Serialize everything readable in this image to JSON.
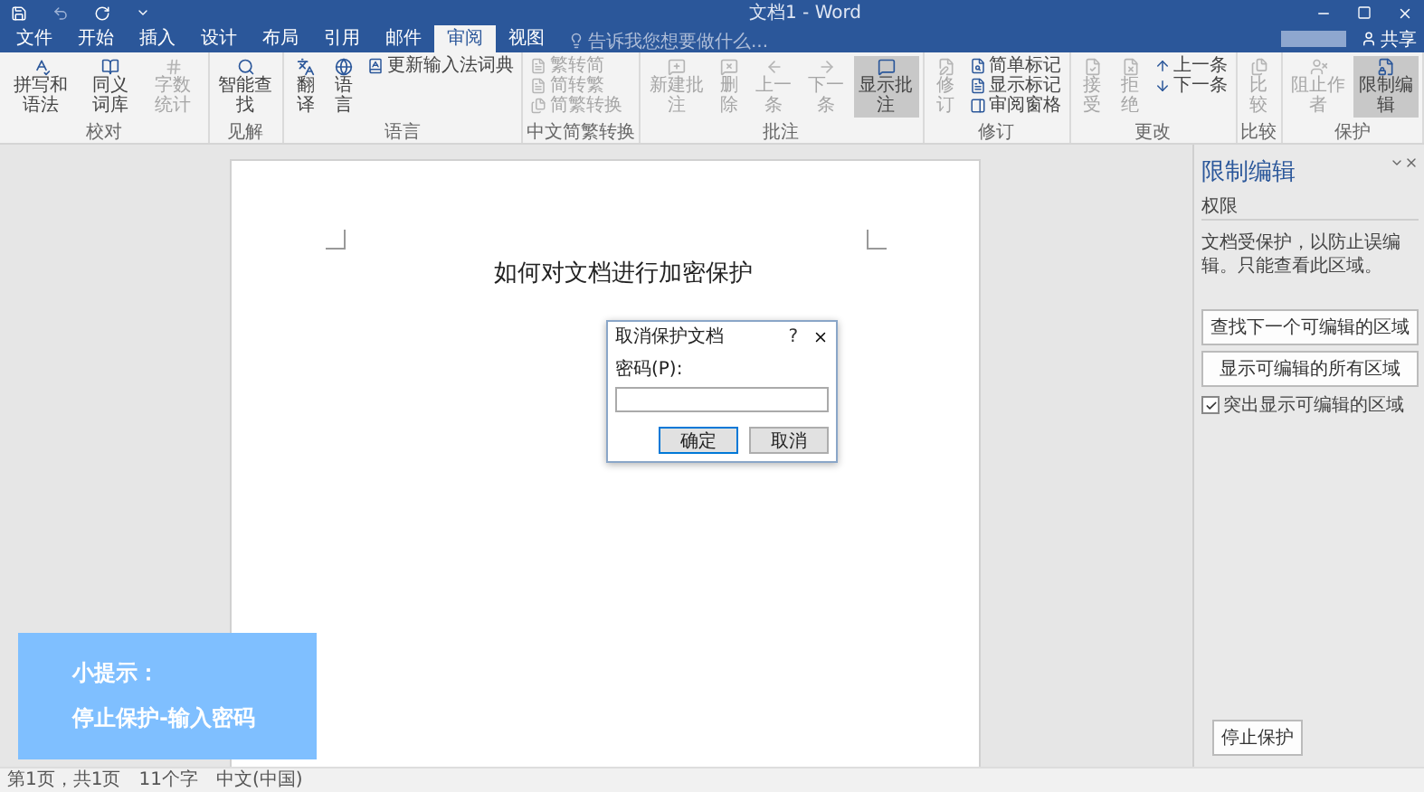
{
  "window": {
    "title": "文档1 - Word",
    "share": "共享"
  },
  "tabs": [
    {
      "label": "文件",
      "selected": false
    },
    {
      "label": "开始",
      "selected": false
    },
    {
      "label": "插入",
      "selected": false
    },
    {
      "label": "设计",
      "selected": false
    },
    {
      "label": "布局",
      "selected": false
    },
    {
      "label": "引用",
      "selected": false
    },
    {
      "label": "邮件",
      "selected": false
    },
    {
      "label": "审阅",
      "selected": true
    },
    {
      "label": "视图",
      "selected": false
    }
  ],
  "search": {
    "placeholder": "告诉我您想要做什么..."
  },
  "ribbon": {
    "groups": [
      {
        "label": "校对",
        "items": [
          {
            "label": "拼写和语法",
            "kind": "large",
            "selected": false,
            "disabled": false
          },
          {
            "label": "同义词库",
            "kind": "large",
            "selected": false,
            "disabled": false
          },
          {
            "label": "字数统计",
            "kind": "large",
            "selected": false,
            "disabled": true
          }
        ]
      },
      {
        "label": "见解",
        "items": [
          {
            "label": "智能查找",
            "kind": "large",
            "selected": false,
            "disabled": false
          }
        ]
      },
      {
        "label": "语言",
        "items": [
          {
            "label": "翻译",
            "kind": "large",
            "selected": false,
            "disabled": false
          },
          {
            "label": "语言",
            "kind": "large",
            "selected": false,
            "disabled": false
          },
          {
            "label": "更新输入法词典",
            "kind": "small",
            "selected": false,
            "disabled": false
          }
        ]
      },
      {
        "label": "中文简繁转换",
        "items": [
          {
            "label": "繁转简",
            "kind": "small",
            "selected": false,
            "disabled": true
          },
          {
            "label": "简转繁",
            "kind": "small",
            "selected": false,
            "disabled": true
          },
          {
            "label": "简繁转换",
            "kind": "small",
            "selected": false,
            "disabled": true
          }
        ]
      },
      {
        "label": "批注",
        "items": [
          {
            "label": "新建批注",
            "kind": "large",
            "selected": false,
            "disabled": true
          },
          {
            "label": "删除",
            "kind": "large",
            "selected": false,
            "disabled": true
          },
          {
            "label": "上一条",
            "kind": "large",
            "selected": false,
            "disabled": true
          },
          {
            "label": "下一条",
            "kind": "large",
            "selected": false,
            "disabled": true
          },
          {
            "label": "显示批注",
            "kind": "large",
            "selected": true,
            "disabled": false
          }
        ]
      },
      {
        "label": "修订",
        "items": [
          {
            "label": "修订",
            "kind": "large",
            "selected": false,
            "disabled": true
          },
          {
            "label": "简单标记",
            "kind": "small",
            "selected": false,
            "disabled": false
          },
          {
            "label": "显示标记",
            "kind": "small",
            "selected": false,
            "disabled": false
          },
          {
            "label": "审阅窗格",
            "kind": "small",
            "selected": false,
            "disabled": false
          }
        ]
      },
      {
        "label": "更改",
        "items": [
          {
            "label": "接受",
            "kind": "large",
            "selected": false,
            "disabled": true
          },
          {
            "label": "拒绝",
            "kind": "large",
            "selected": false,
            "disabled": true
          },
          {
            "label": "上一条",
            "kind": "small",
            "selected": false,
            "disabled": false
          },
          {
            "label": "下一条",
            "kind": "small",
            "selected": false,
            "disabled": false
          }
        ]
      },
      {
        "label": "比较",
        "items": [
          {
            "label": "比较",
            "kind": "large",
            "selected": false,
            "disabled": true
          }
        ]
      },
      {
        "label": "保护",
        "items": [
          {
            "label": "阻止作者",
            "kind": "large",
            "selected": false,
            "disabled": true
          },
          {
            "label": "限制编辑",
            "kind": "large",
            "selected": true,
            "disabled": false
          }
        ]
      }
    ]
  },
  "document": {
    "text": "如何对文档进行加密保护"
  },
  "dialog": {
    "title": "取消保护文档",
    "help": "?",
    "label": "密码(P):",
    "buttons": [
      {
        "label": "确定",
        "default": true
      },
      {
        "label": "取消",
        "default": false
      }
    ]
  },
  "pane": {
    "title": "限制编辑",
    "heading": "权限",
    "text": "文档受保护，以防止误编辑。只能查看此区域。",
    "buttons": [
      "查找下一个可编辑的区域",
      "显示可编辑的所有区域"
    ],
    "checkbox": {
      "label": "突出显示可编辑的区域",
      "checked": true
    },
    "stop": "停止保护"
  },
  "tip": {
    "title": "小提示：",
    "text": "停止保护-输入密码"
  },
  "status_bar": {
    "items": [
      "第1页，共1页",
      "11个字",
      "中文(中国)"
    ]
  }
}
